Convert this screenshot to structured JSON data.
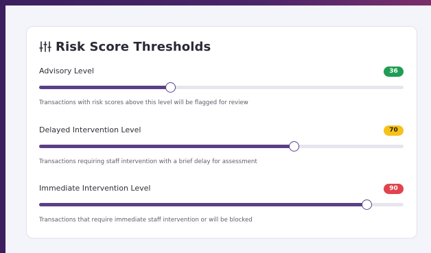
{
  "title": "Risk Score Thresholds",
  "title_icon": "sliders-icon",
  "levels": [
    {
      "label": "Advisory Level",
      "value": 36,
      "badge_text": "36",
      "badge_color": "#1f9d55",
      "description": "Transactions with risk scores above this level will be flagged for review"
    },
    {
      "label": "Delayed Intervention Level",
      "value": 70,
      "badge_text": "70",
      "badge_color": "#f6c21a",
      "description": "Transactions requiring staff intervention with a brief delay for assessment"
    },
    {
      "label": "Immediate Intervention Level",
      "value": 90,
      "badge_text": "90",
      "badge_color": "#e0444e",
      "description": "Transactions that require immediate staff intervention or will be blocked"
    }
  ],
  "slider_range": [
    0,
    100
  ],
  "colors": {
    "accent": "#5b3f86",
    "track": "#e7e6ee"
  }
}
